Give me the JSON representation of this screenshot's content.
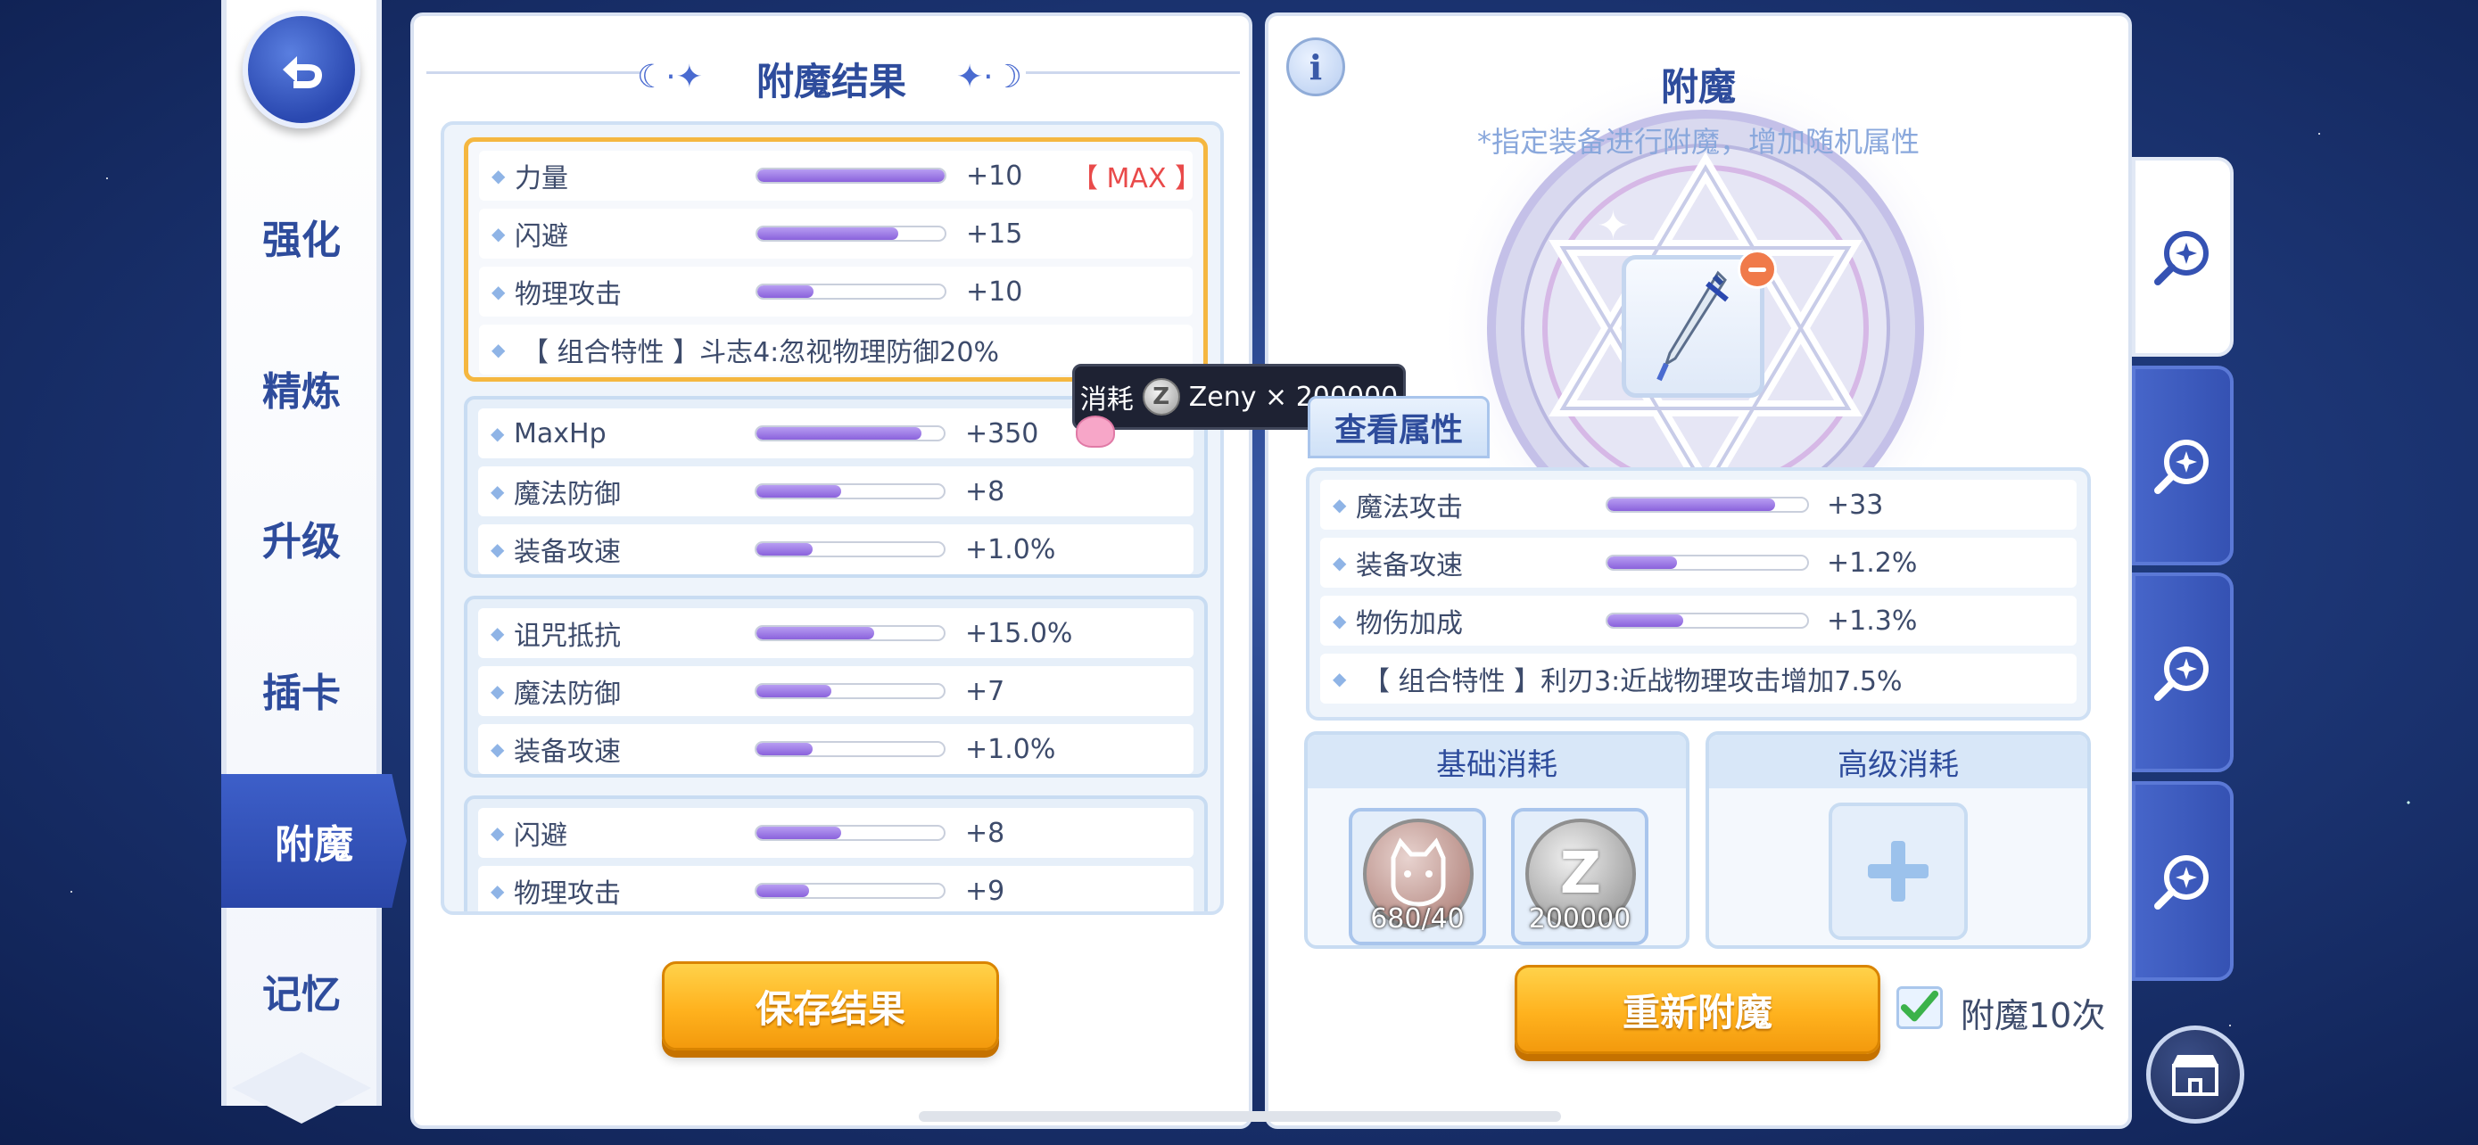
{
  "nav": {
    "items": [
      {
        "label": "强化"
      },
      {
        "label": "精炼"
      },
      {
        "label": "升级"
      },
      {
        "label": "插卡"
      },
      {
        "label": "附魔"
      },
      {
        "label": "记忆"
      }
    ],
    "active": "附魔"
  },
  "result_panel": {
    "title": "附魔结果",
    "groups": [
      {
        "rows": [
          {
            "name": "力量",
            "fill": 1.0,
            "value": "+10",
            "tag": "【 MAX 】"
          },
          {
            "name": "闪避",
            "fill": 0.75,
            "value": "+15"
          },
          {
            "name": "物理攻击",
            "fill": 0.3,
            "value": "+10"
          }
        ],
        "combo": "【 组合特性 】斗志4:忽视物理防御20%"
      },
      {
        "rows": [
          {
            "name": "MaxHp",
            "fill": 0.88,
            "value": "+350"
          },
          {
            "name": "魔法防御",
            "fill": 0.45,
            "value": "+8"
          },
          {
            "name": "装备攻速",
            "fill": 0.3,
            "value": "+1.0%"
          }
        ]
      },
      {
        "rows": [
          {
            "name": "诅咒抵抗",
            "fill": 0.63,
            "value": "+15.0%"
          },
          {
            "name": "魔法防御",
            "fill": 0.4,
            "value": "+7"
          },
          {
            "name": "装备攻速",
            "fill": 0.3,
            "value": "+1.0%"
          }
        ]
      },
      {
        "rows": [
          {
            "name": "闪避",
            "fill": 0.45,
            "value": "+8"
          },
          {
            "name": "物理攻击",
            "fill": 0.28,
            "value": "+9"
          }
        ]
      }
    ],
    "save_button": "保存结果"
  },
  "tooltip": {
    "prefix": "消耗",
    "coin_letter": "Z",
    "text": "Zeny × 200000"
  },
  "enchant_panel": {
    "info_icon": "i",
    "title": "附魔",
    "subtitle": "*指定装备进行附魔，增加随机属性",
    "attr_tab": "查看属性",
    "attributes": [
      {
        "name": "魔法攻击",
        "fill": 0.84,
        "value": "+33"
      },
      {
        "name": "装备攻速",
        "fill": 0.35,
        "value": "+1.2%"
      },
      {
        "name": "物伤加成",
        "fill": 0.38,
        "value": "+1.3%"
      }
    ],
    "combo": "【 组合特性 】利刃3:近战物理攻击增加7.5%",
    "basic_cost": {
      "title": "基础消耗",
      "items": [
        {
          "icon": "cat-coin-icon",
          "label": "680/40",
          "color": "#b98a84"
        },
        {
          "icon": "zeny-coin-icon",
          "label": "200000",
          "color": "#9a9a9a",
          "letter": "Z"
        }
      ]
    },
    "advanced_cost": {
      "title": "高级消耗"
    },
    "reenchant_button": "重新附魔",
    "checkbox": {
      "checked": true,
      "label": "附魔10次"
    }
  },
  "colors": {
    "accent": "#2e4c9c",
    "orange": "#ffb21e",
    "max_red": "#e94a4a",
    "bar": "#8a62dc"
  }
}
